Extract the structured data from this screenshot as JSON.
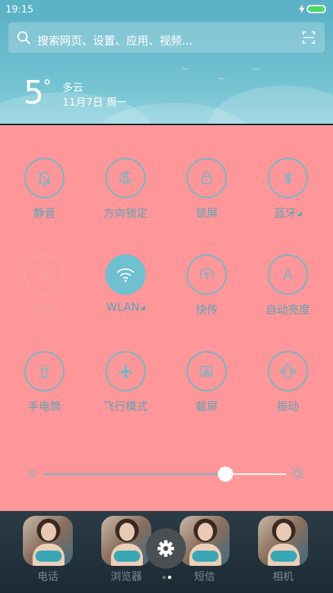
{
  "status_bar": {
    "time": "19:15"
  },
  "search": {
    "placeholder": "搜索网页、设置、应用、视频..."
  },
  "weather": {
    "temperature": "5",
    "degree_symbol": "°",
    "condition": "多云",
    "date": "11月7日 周一"
  },
  "quick_toggles": [
    {
      "label": "静音",
      "icon": "bell-off-icon",
      "state": "off"
    },
    {
      "label": "方向锁定",
      "icon": "rotation-lock-icon",
      "state": "off"
    },
    {
      "label": "锁屏",
      "icon": "lock-icon",
      "state": "off"
    },
    {
      "label": "蓝牙",
      "icon": "bluetooth-icon",
      "state": "off",
      "has_menu": true
    },
    {
      "label": "数据",
      "icon": "mobile-data-icon",
      "state": "disabled"
    },
    {
      "label": "WLAN",
      "icon": "wifi-icon",
      "state": "on",
      "has_menu": true
    },
    {
      "label": "快传",
      "icon": "quick-transfer-icon",
      "state": "off"
    },
    {
      "label": "自动亮度",
      "icon": "auto-brightness-icon",
      "state": "off"
    },
    {
      "label": "手电筒",
      "icon": "flashlight-icon",
      "state": "off"
    },
    {
      "label": "飞行模式",
      "icon": "airplane-icon",
      "state": "off"
    },
    {
      "label": "截屏",
      "icon": "screenshot-icon",
      "state": "off"
    },
    {
      "label": "振动",
      "icon": "vibrate-icon",
      "state": "off"
    }
  ],
  "brightness": {
    "level": 0.75
  },
  "dock": {
    "apps": [
      {
        "label": "电话"
      },
      {
        "label": "浏览器"
      },
      {
        "label": "短信"
      },
      {
        "label": "相机"
      }
    ]
  },
  "pager": {
    "pages": 2,
    "current": 2
  },
  "colors": {
    "panel_bg": "#ff9699",
    "accent": "#6fc0d0",
    "label": "#5ea4b6",
    "disabled": "#f4a2a4",
    "header_bg": "#5fb4c7"
  }
}
